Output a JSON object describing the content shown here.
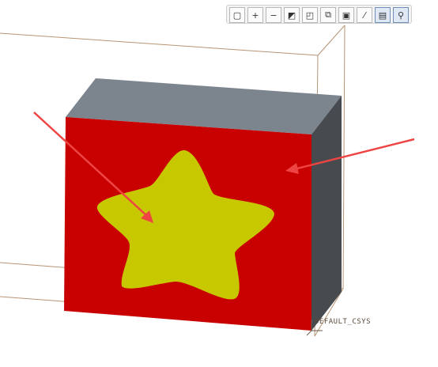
{
  "toolbar": {
    "buttons": [
      {
        "name": "zoom-fit-icon",
        "glyph": "▢",
        "active": false
      },
      {
        "name": "zoom-in-icon",
        "glyph": "+",
        "active": false
      },
      {
        "name": "zoom-out-icon",
        "glyph": "−",
        "active": false
      },
      {
        "name": "repaint-icon",
        "glyph": "◩",
        "active": false
      },
      {
        "name": "display-style-icon",
        "glyph": "◰",
        "active": false
      },
      {
        "name": "saved-orientation-icon",
        "glyph": "⧉",
        "active": false
      },
      {
        "name": "view-manager-icon",
        "glyph": "▣",
        "active": false
      },
      {
        "name": "datum-display-icon",
        "glyph": "⁄",
        "active": false
      },
      {
        "name": "annotation-display-icon",
        "glyph": "▤",
        "active": true
      },
      {
        "name": "spin-center-icon",
        "glyph": "⚲",
        "active": true
      }
    ]
  },
  "model": {
    "front_color": "#c80000",
    "top_color": "#7c858e",
    "side_color": "#474b50",
    "star_color": "#c8c800",
    "frame_color": "#b79473",
    "arrow_color": "#ee4444"
  },
  "csys": {
    "label": "DEFAULT_CSYS"
  }
}
